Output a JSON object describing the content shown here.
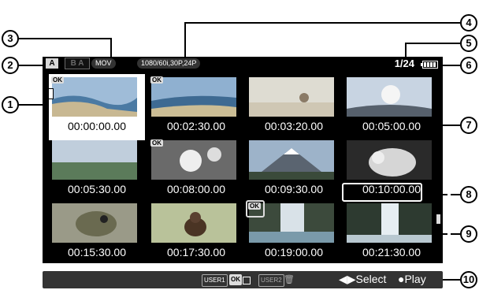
{
  "status_bar": {
    "slot_a": "A",
    "slot_ba": "B A",
    "format": "MOV",
    "resolution": "1080/60i,30P,24P",
    "counter": "1/24"
  },
  "clips": [
    {
      "timecode": "00:00:00.00",
      "ok": true,
      "selected": true
    },
    {
      "timecode": "00:02:30.00",
      "ok": true
    },
    {
      "timecode": "00:03:20.00",
      "ok": false
    },
    {
      "timecode": "00:05:00.00",
      "ok": false
    },
    {
      "timecode": "00:05:30.00",
      "ok": false
    },
    {
      "timecode": "00:08:00.00",
      "ok": true
    },
    {
      "timecode": "00:09:30.00",
      "ok": false
    },
    {
      "timecode": "00:10:00.00",
      "ok": false,
      "boxed": true
    },
    {
      "timecode": "00:15:30.00",
      "ok": false
    },
    {
      "timecode": "00:17:30.00",
      "ok": false
    },
    {
      "timecode": "00:19:00.00",
      "ok": true,
      "ok_boxed": true
    },
    {
      "timecode": "00:21:30.00",
      "ok": false,
      "arrow_right": true
    }
  ],
  "ok_mark": "OK",
  "bottom_bar": {
    "user1": "USER1",
    "ok": "OK",
    "user2": "USER2",
    "select": "◀▶Select",
    "play": "●Play"
  },
  "callouts": [
    "1",
    "2",
    "3",
    "4",
    "5",
    "6",
    "7",
    "8",
    "9",
    "10"
  ]
}
